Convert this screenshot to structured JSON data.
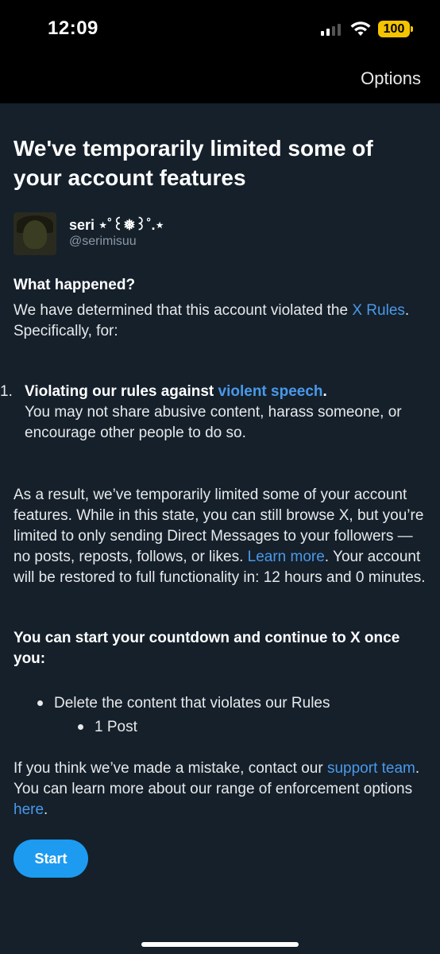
{
  "status_bar": {
    "time": "12:09",
    "battery": "100"
  },
  "nav": {
    "options_label": "Options"
  },
  "page": {
    "title": "We've temporarily limited some of your account features",
    "user": {
      "display_name": "seri ⋆˚꒰❅꒱˚.⋆",
      "handle": "@serimisuu"
    },
    "what_happened_heading": "What happened?",
    "determined_text": "We have determined that this account violated the ",
    "x_rules_link": "X Rules",
    "specifically_text": ". Specifically, for:",
    "violation": {
      "number": "1.",
      "title_prefix": "Violating our rules against ",
      "title_link": "violent speech",
      "title_suffix": ".",
      "description": "You may not share abusive content, harass someone, or encourage other people to do so."
    },
    "result_text": "As a result, we’ve temporarily limited some of your account features. While in this state, you can still browse X, but you’re limited to only sending Direct Messages to your followers — no posts, reposts, follows, or likes. ",
    "learn_more_link": "Learn more",
    "restore_text": ". Your account will be restored to full functionality in: 12 hours and 0 minutes.",
    "countdown_heading": "You can start your countdown and continue to X once you:",
    "requirement": "Delete the content that violates our Rules",
    "sub_requirement": "1 Post",
    "mistake_text": "If you think we’ve made a mistake, contact our ",
    "support_link": "support team",
    "enforcement_text": ". You can learn more about our range of enforcement options ",
    "here_link": "here",
    "period": ".",
    "start_button": "Start"
  },
  "colors": {
    "background": "#15202b",
    "link": "#4a99e9",
    "button": "#1d9bf0",
    "battery": "#f5c400"
  }
}
